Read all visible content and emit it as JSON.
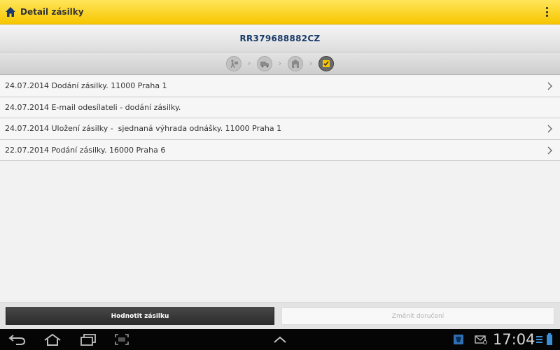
{
  "action_bar": {
    "title": "Detail zásilky",
    "home_icon": "home-icon",
    "overflow_icon": "overflow-menu-icon",
    "accent_color": "#f7c600"
  },
  "tracking": {
    "number": "RR379688882CZ",
    "color": "#1a3a6b"
  },
  "steps": [
    {
      "icon": "posting-step-icon",
      "state": "inactive"
    },
    {
      "icon": "transport-step-icon",
      "state": "inactive"
    },
    {
      "icon": "post-office-step-icon",
      "state": "inactive"
    },
    {
      "icon": "delivered-step-icon",
      "state": "active"
    }
  ],
  "events": [
    {
      "text": "24.07.2014 Dodání zásilky. 11000 Praha 1",
      "has_detail": true
    },
    {
      "text": "24.07.2014 E-mail odesílateli - dodání zásilky.",
      "has_detail": false
    },
    {
      "text": "24.07.2014 Uložení zásilky -  sjednaná výhrada odnášky. 11000 Praha 1",
      "has_detail": true
    },
    {
      "text": "22.07.2014 Podání zásilky. 16000 Praha 6",
      "has_detail": true
    }
  ],
  "buttons": {
    "rate_label": "Hodnotit zásilku",
    "change_label": "Změnit doručení"
  },
  "system_bar": {
    "time": "17:04",
    "icons": [
      "back-icon",
      "home-nav-icon",
      "recent-apps-icon",
      "screenshot-icon",
      "up-arrow-icon",
      "notification-icon",
      "email-icon",
      "signal-icon",
      "battery-icon"
    ]
  }
}
